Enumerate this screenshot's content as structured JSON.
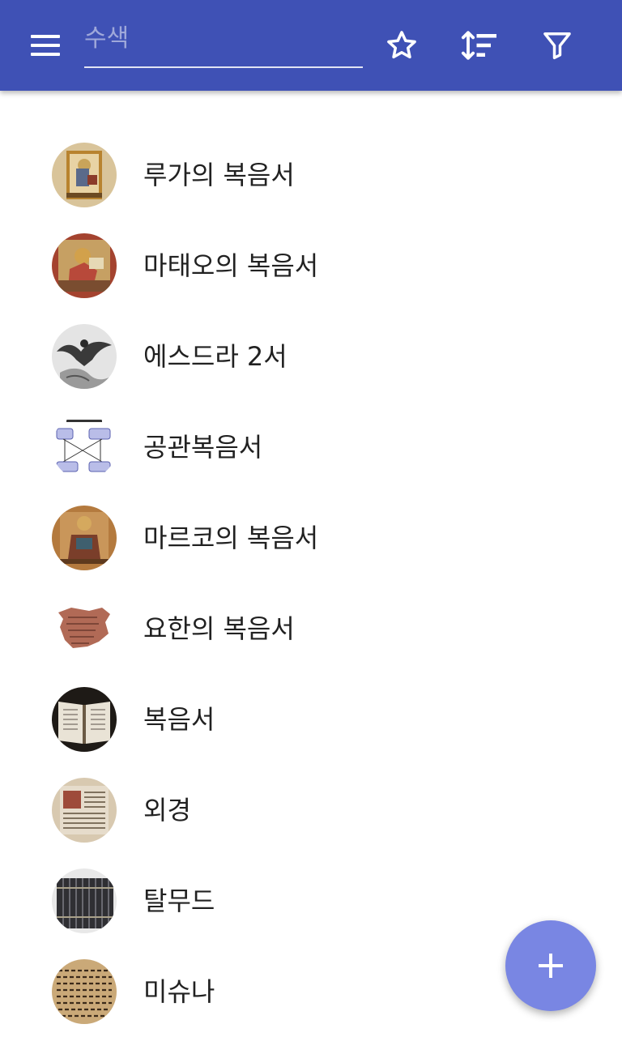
{
  "toolbar": {
    "menu_icon": "menu-icon",
    "search_placeholder": "수색",
    "search_value": "",
    "favorite_icon": "star-outline-icon",
    "sort_icon": "sort-icon",
    "filter_icon": "filter-icon",
    "background_color": "#3f51b5"
  },
  "articles": [
    {
      "title": "루가의 복음서",
      "thumbnail": "illuminated-manuscript-thumbnail"
    },
    {
      "title": "마태오의 복음서",
      "thumbnail": "illuminated-manuscript-thumbnail"
    },
    {
      "title": "에스드라 2서",
      "thumbnail": "eagle-engraving-thumbnail"
    },
    {
      "title": "공관복음서",
      "thumbnail": "synoptic-diagram-thumbnail"
    },
    {
      "title": "마르코의 복음서",
      "thumbnail": "illuminated-manuscript-thumbnail"
    },
    {
      "title": "요한의 복음서",
      "thumbnail": "papyrus-fragment-thumbnail"
    },
    {
      "title": "복음서",
      "thumbnail": "open-book-thumbnail"
    },
    {
      "title": "외경",
      "thumbnail": "old-manuscript-thumbnail"
    },
    {
      "title": "탈무드",
      "thumbnail": "bookshelf-thumbnail"
    },
    {
      "title": "미슈나",
      "thumbnail": "hebrew-text-thumbnail"
    }
  ],
  "fab": {
    "icon": "plus-icon",
    "color": "#7986e3"
  }
}
